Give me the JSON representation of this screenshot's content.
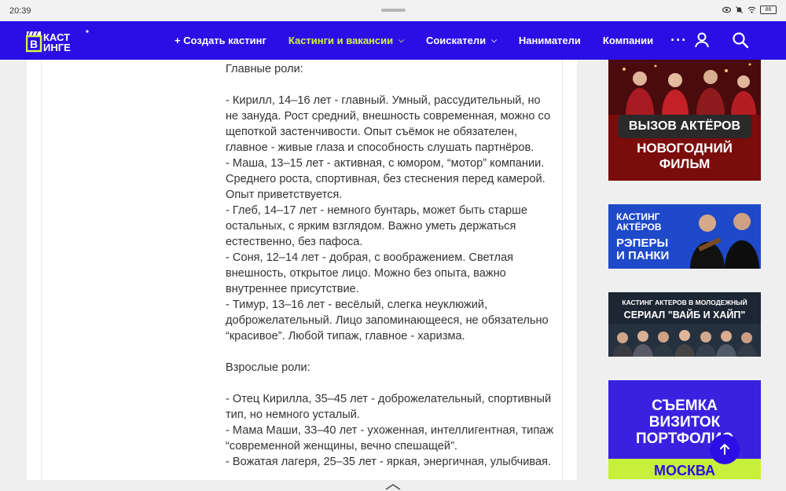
{
  "status_bar": {
    "time": "20:39",
    "battery": "86"
  },
  "navbar": {
    "logo_line1": "КАСТ",
    "logo_line2": "ИНГЕ",
    "logo_letter": "В",
    "items": [
      {
        "label": "+ Создать кастинг",
        "active": false,
        "has_dropdown": false
      },
      {
        "label": "Кастинги и вакансии",
        "active": true,
        "has_dropdown": true
      },
      {
        "label": "Соискатели",
        "active": false,
        "has_dropdown": true
      },
      {
        "label": "Наниматели",
        "active": false,
        "has_dropdown": false
      },
      {
        "label": "Компании",
        "active": false,
        "has_dropdown": false
      }
    ],
    "more": "···"
  },
  "article": {
    "lines": [
      "Главные роли:",
      "",
      "- Кирилл, 14–16 лет - главный. Умный, рассудительный, но не зануда. Рост средний, внешность современная, можно со щепоткой застенчивости. Опыт съёмок не обязателен, главное - живые глаза и способность слушать партнёров.",
      "- Маша, 13–15 лет - активная, с юмором, “мотор” компании. Среднего роста, спортивная, без стеснения перед камерой. Опыт приветствуется.",
      "- Глеб, 14–17 лет - немного бунтарь, может быть старше остальных, с ярким взглядом. Важно уметь держаться естественно, без пафоса.",
      "- Соня, 12–14 лет - добрая, с воображением. Светлая внешность, открытое лицо. Можно без опыта, важно внутреннее присутствие.",
      "- Тимур, 13–16 лет - весёлый, слегка неуклюжий, доброжелательный. Лицо запоминающееся, не обязательно “красивое”. Любой типаж, главное - харизма.",
      "",
      "Взрослые роли:",
      "",
      "- Отец Кирилла, 35–45 лет - доброжелательный, спортивный тип, но немного усталый.",
      "- Мама Маши, 33–40 лет - ухоженная, интеллигентная, типаж “современной женщины, вечно спешащей”.",
      "- Вожатая лагеря, 25–35 лет - яркая, энергичная, улыбчивая."
    ]
  },
  "ads": {
    "ad1": {
      "pill": "ВЫЗОВ АКТЁРОВ",
      "line1": "НОВОГОДНИЙ",
      "line2": "ФИЛЬМ"
    },
    "ad2": {
      "line1": "КАСТИНГ",
      "line2": "АКТЁРОВ",
      "line3": "РЭПЕРЫ",
      "line4": "И ПАНКИ"
    },
    "ad3": {
      "line1": "КАСТИНГ АКТЕРОВ В МОЛОДЕЖНЫЙ",
      "line2": "СЕРИАЛ \"ВАЙБ И ХАЙП\""
    },
    "ad4": {
      "line1": "СЪЕМКА",
      "line2": "ВИЗИТОК",
      "line3": "ПОРТФОЛИО",
      "stripe": "МОСКВА"
    }
  },
  "colors": {
    "brand_blue": "#2b0ee5",
    "accent_lime": "#d4f542"
  }
}
